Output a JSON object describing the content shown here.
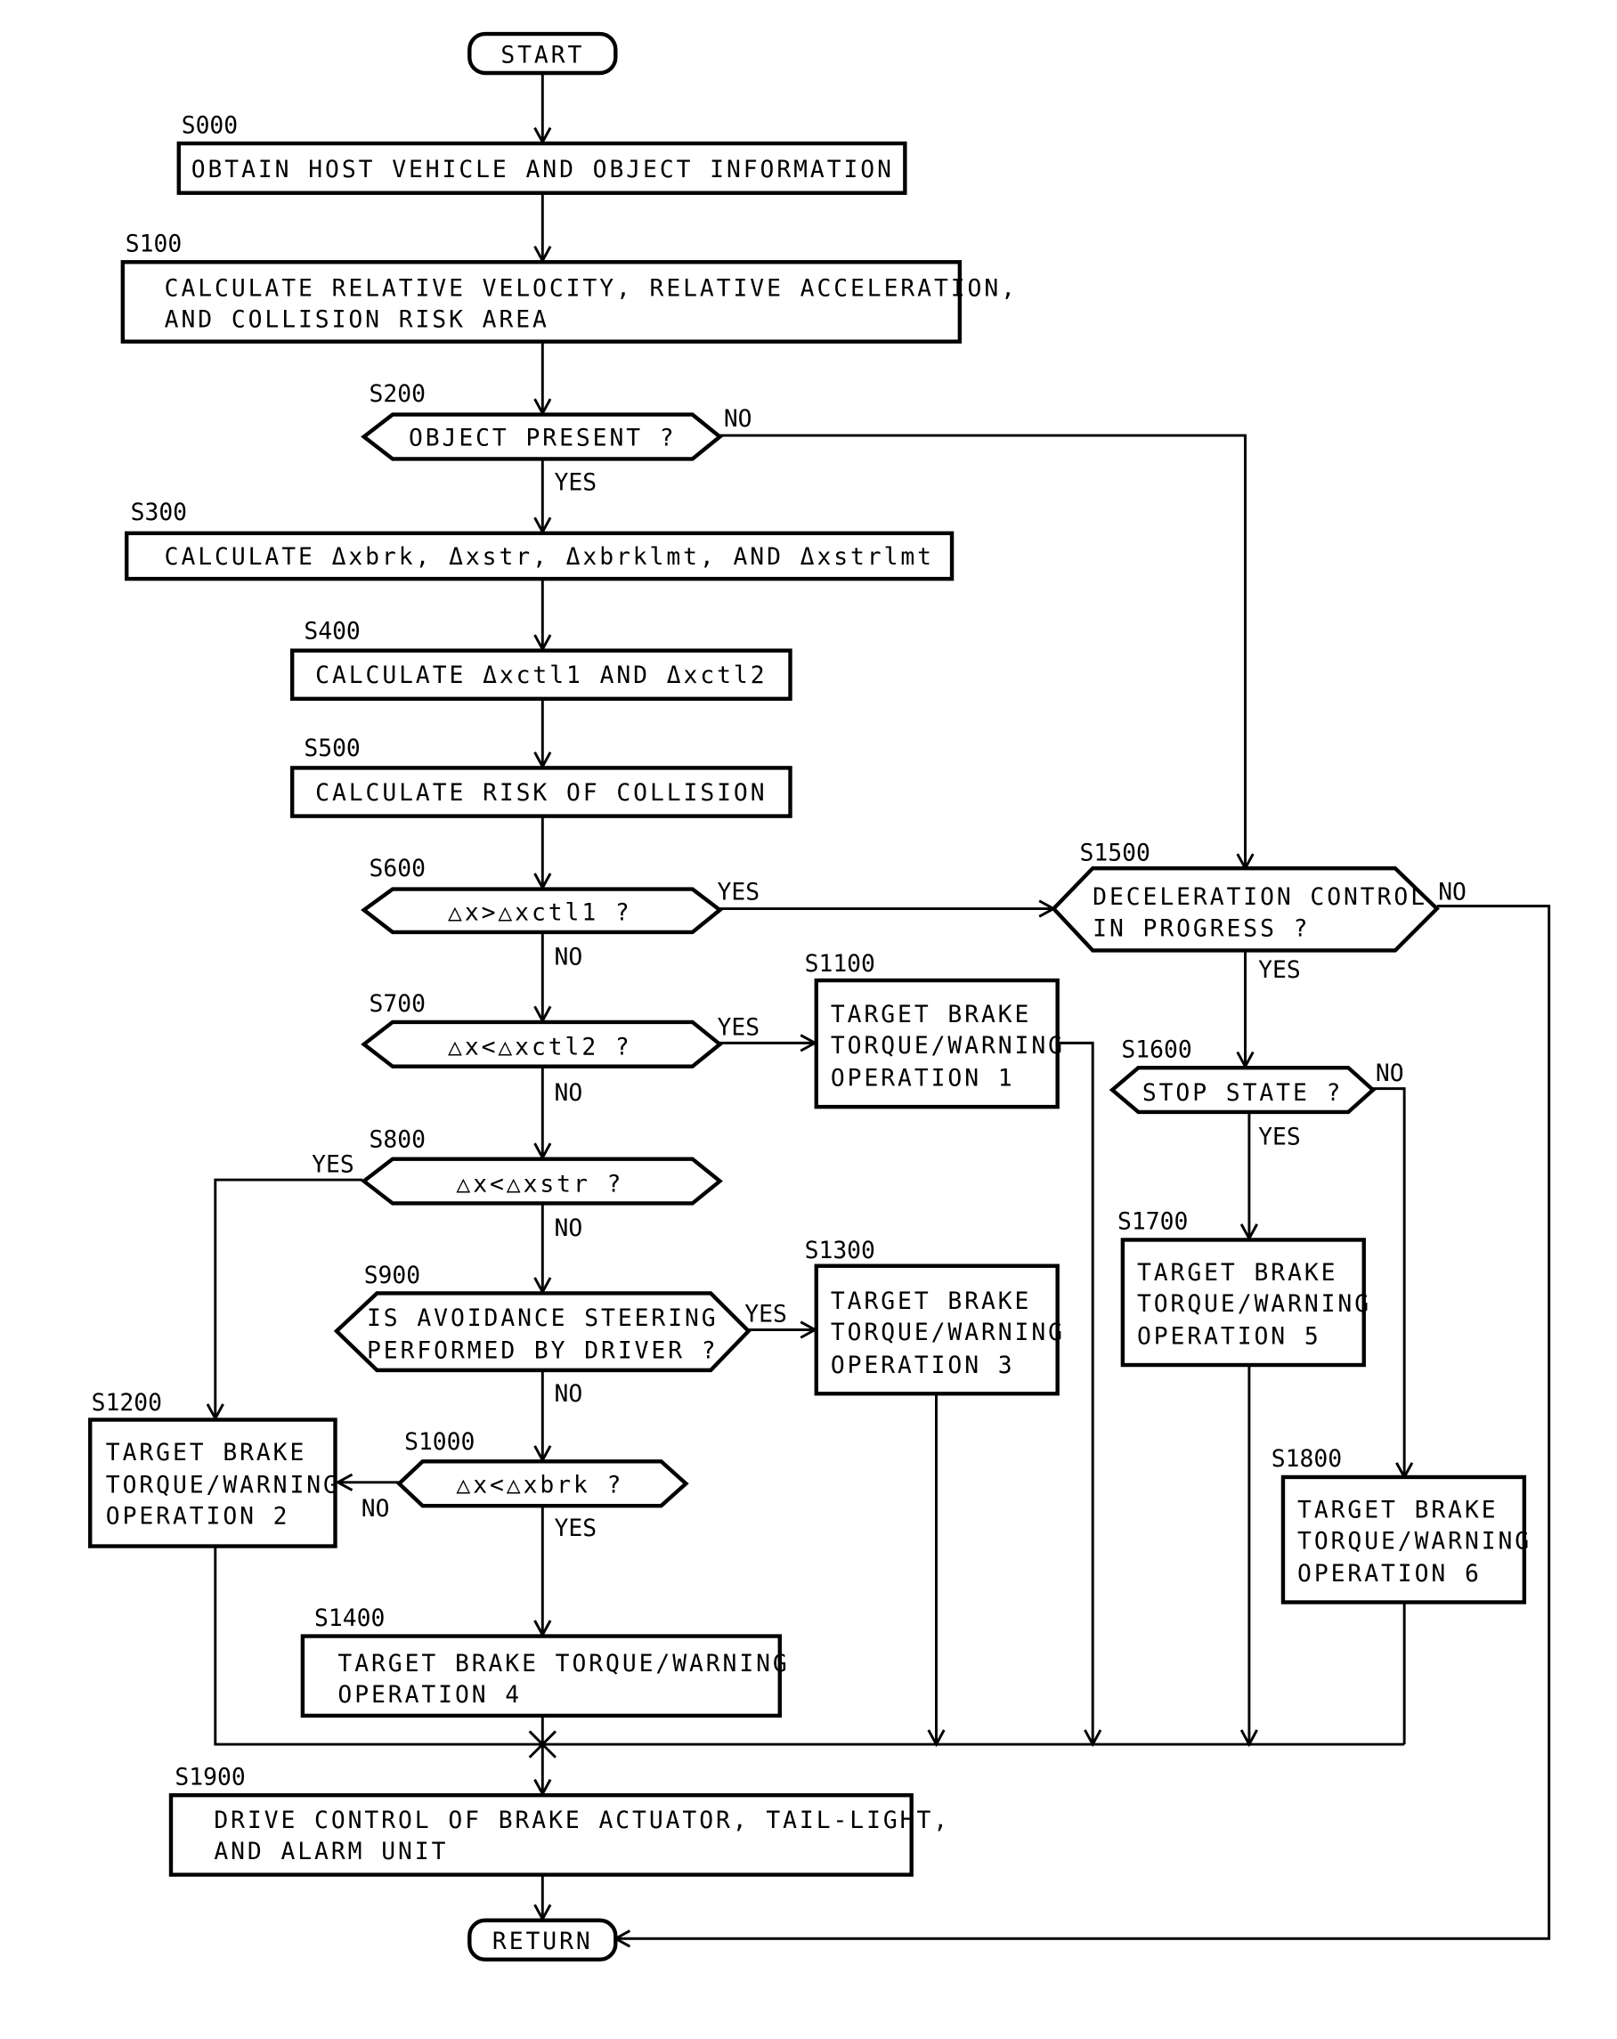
{
  "terminals": {
    "start": "START",
    "return": "RETURN"
  },
  "steps": {
    "S000": {
      "id": "S000",
      "lines": [
        "OBTAIN HOST VEHICLE AND OBJECT INFORMATION"
      ]
    },
    "S100": {
      "id": "S100",
      "lines": [
        "CALCULATE RELATIVE VELOCITY, RELATIVE ACCELERATION,",
        "AND COLLISION RISK AREA"
      ]
    },
    "S200": {
      "id": "S200",
      "lines": [
        "OBJECT PRESENT ?"
      ]
    },
    "S300": {
      "id": "S300",
      "lines": [
        "CALCULATE Δxbrk, Δxstr, Δxbrklmt, AND Δxstrlmt"
      ]
    },
    "S400": {
      "id": "S400",
      "lines": [
        "CALCULATE Δxctl1 AND Δxctl2"
      ]
    },
    "S500": {
      "id": "S500",
      "lines": [
        "CALCULATE RISK OF COLLISION"
      ]
    },
    "S600": {
      "id": "S600",
      "lines": [
        "△x>△xctl1 ?"
      ]
    },
    "S700": {
      "id": "S700",
      "lines": [
        "△x<△xctl2 ?"
      ]
    },
    "S800": {
      "id": "S800",
      "lines": [
        "△x<△xstr ?"
      ]
    },
    "S900": {
      "id": "S900",
      "lines": [
        "IS AVOIDANCE STEERING",
        "PERFORMED BY DRIVER ?"
      ]
    },
    "S1000": {
      "id": "S1000",
      "lines": [
        "△x<△xbrk ?"
      ]
    },
    "S1100": {
      "id": "S1100",
      "lines": [
        "TARGET BRAKE",
        "TORQUE/WARNING",
        "OPERATION 1"
      ]
    },
    "S1200": {
      "id": "S1200",
      "lines": [
        "TARGET BRAKE",
        "TORQUE/WARNING",
        "OPERATION 2"
      ]
    },
    "S1300": {
      "id": "S1300",
      "lines": [
        "TARGET BRAKE",
        "TORQUE/WARNING",
        "OPERATION 3"
      ]
    },
    "S1400": {
      "id": "S1400",
      "lines": [
        "TARGET BRAKE TORQUE/WARNING",
        "OPERATION 4"
      ]
    },
    "S1500": {
      "id": "S1500",
      "lines": [
        "DECELERATION CONTROL",
        "IN PROGRESS ?"
      ]
    },
    "S1600": {
      "id": "S1600",
      "lines": [
        "STOP STATE ?"
      ]
    },
    "S1700": {
      "id": "S1700",
      "lines": [
        "TARGET BRAKE",
        "TORQUE/WARNING",
        "OPERATION 5"
      ]
    },
    "S1800": {
      "id": "S1800",
      "lines": [
        "TARGET BRAKE",
        "TORQUE/WARNING",
        "OPERATION 6"
      ]
    },
    "S1900": {
      "id": "S1900",
      "lines": [
        "DRIVE CONTROL OF BRAKE ACTUATOR, TAIL-LIGHT,",
        "AND ALARM UNIT"
      ]
    }
  },
  "branches": {
    "yes": "YES",
    "no": "NO"
  }
}
